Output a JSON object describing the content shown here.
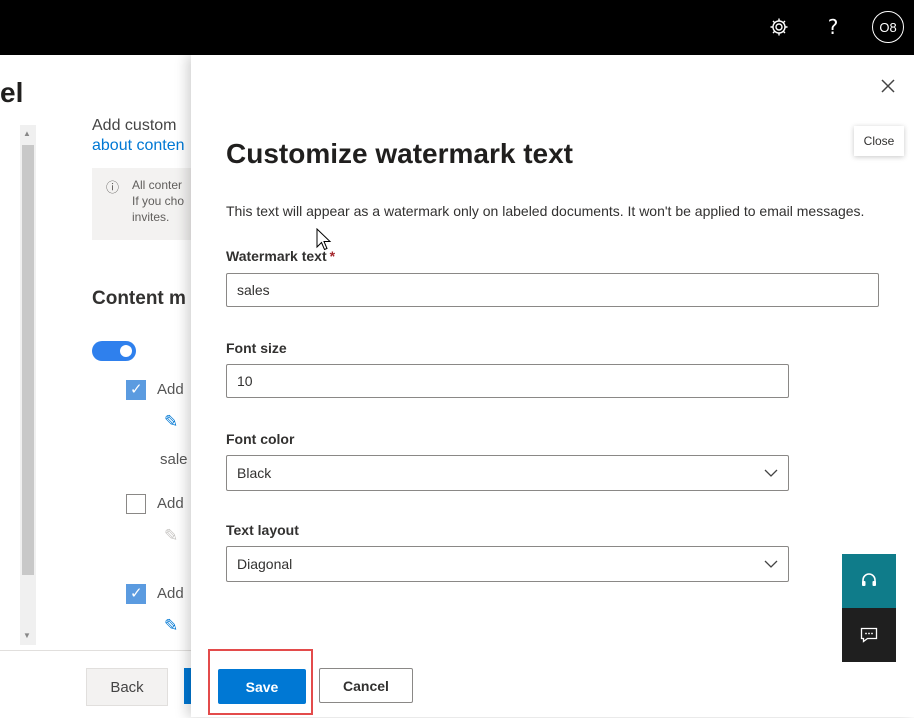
{
  "topbar": {
    "icons": [
      "gear-icon",
      "help-icon",
      "avatar"
    ],
    "help_label": "?",
    "avatar_initials": "O8"
  },
  "background": {
    "title_fragment": "el",
    "text_fragment_1": "Add custom",
    "link_fragment": "about conten",
    "info_lines": [
      "All conter",
      "If you cho",
      "invites."
    ],
    "section_heading": "Content m",
    "checkbox_items": [
      {
        "label": "Add",
        "checked": true
      },
      {
        "label": "Add",
        "checked": false
      },
      {
        "label": "Add",
        "checked": true
      }
    ],
    "value_fragment": "sale",
    "back_label": "Back"
  },
  "panel": {
    "close_tooltip": "Close",
    "title": "Customize watermark text",
    "description": "This text will appear as a watermark only on labeled documents. It won't be applied to email messages.",
    "fields": {
      "watermark_text": {
        "label": "Watermark text",
        "required_mark": "*",
        "value": "sales"
      },
      "font_size": {
        "label": "Font size",
        "value": "10"
      },
      "font_color": {
        "label": "Font color",
        "value": "Black"
      },
      "text_layout": {
        "label": "Text layout",
        "value": "Diagonal"
      }
    },
    "save_label": "Save",
    "cancel_label": "Cancel"
  },
  "colors": {
    "accent": "#0078d4",
    "help_float": "#0f7c8a",
    "highlight": "#e34b4b"
  }
}
